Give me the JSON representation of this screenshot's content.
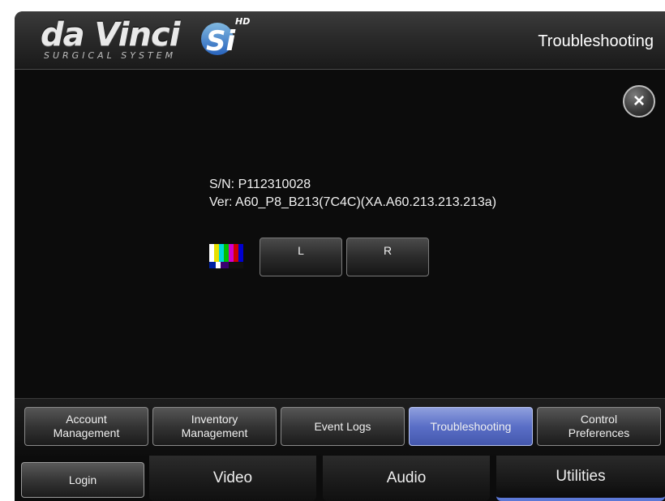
{
  "header": {
    "logo_text": "da Vinci",
    "logo_sub": "SURGICAL SYSTEM",
    "logo_si": "Si",
    "logo_hd": "HD",
    "title": "Troubleshooting"
  },
  "close_icon": "×",
  "info": {
    "serial": "S/N: P112310028",
    "version": "Ver: A60_P8_B213(7C4C)(XA.A60.213.213.213a)"
  },
  "buttons": {
    "left": "L",
    "right": "R"
  },
  "subtabs": [
    {
      "line1": "Account",
      "line2": "Management"
    },
    {
      "line1": "Inventory",
      "line2": "Management"
    },
    {
      "line1": "Event Logs",
      "line2": ""
    },
    {
      "line1": "Troubleshooting",
      "line2": ""
    },
    {
      "line1": "Control",
      "line2": "Preferences"
    }
  ],
  "active_subtab": "Troubleshooting",
  "maintabs": {
    "login": "Login",
    "video": "Video",
    "audio": "Audio",
    "utilities": "Utilities"
  },
  "active_maintab": "Utilities",
  "colors": {
    "accent": "#5a6fc7",
    "background": "#0c0c0c"
  },
  "icons": {
    "close": "close-icon",
    "test_pattern": "color-bars-icon"
  }
}
